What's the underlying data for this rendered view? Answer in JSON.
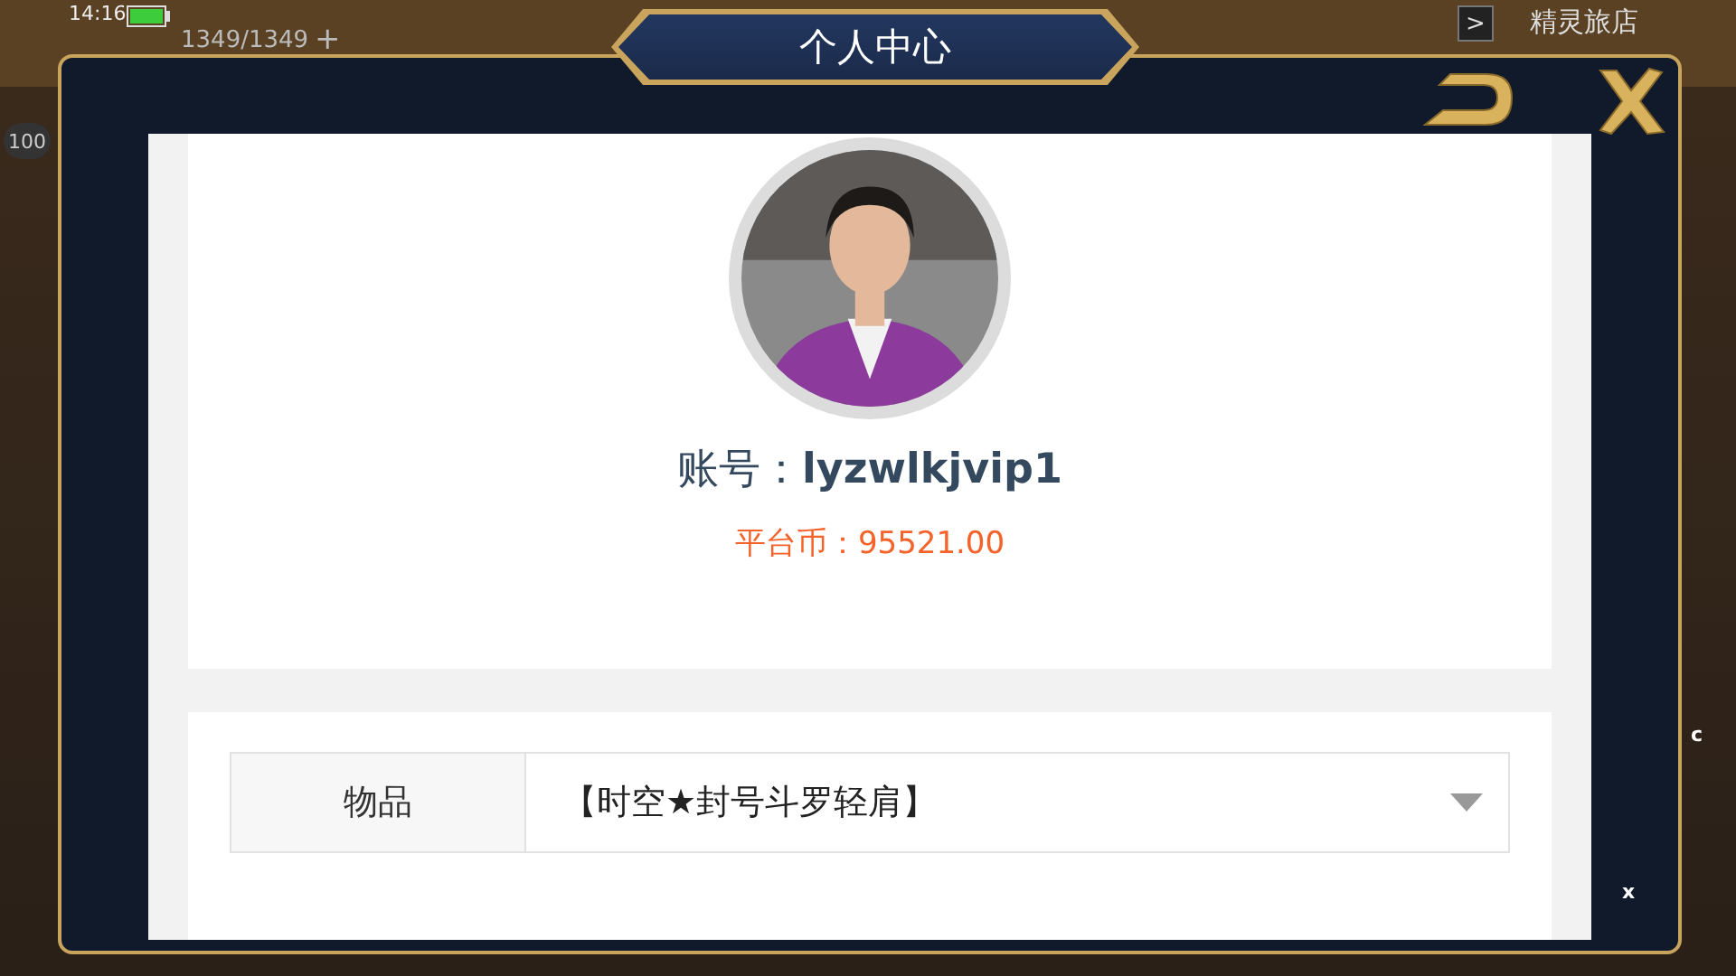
{
  "game_hud": {
    "time": "14:16",
    "energy": "1349/1349",
    "energy_add": "+",
    "level": "100",
    "shop_toggle": ">",
    "shop_name": "精灵旅店",
    "side_markers": [
      "c",
      "x"
    ]
  },
  "dialog": {
    "title": "个人中心"
  },
  "profile": {
    "account_label": "账号：",
    "account": "lyzwlkjvip1",
    "coins": "平台币：95521.00"
  },
  "item_select": {
    "label": "物品",
    "value": "【时空★封号斗罗轻肩】"
  }
}
